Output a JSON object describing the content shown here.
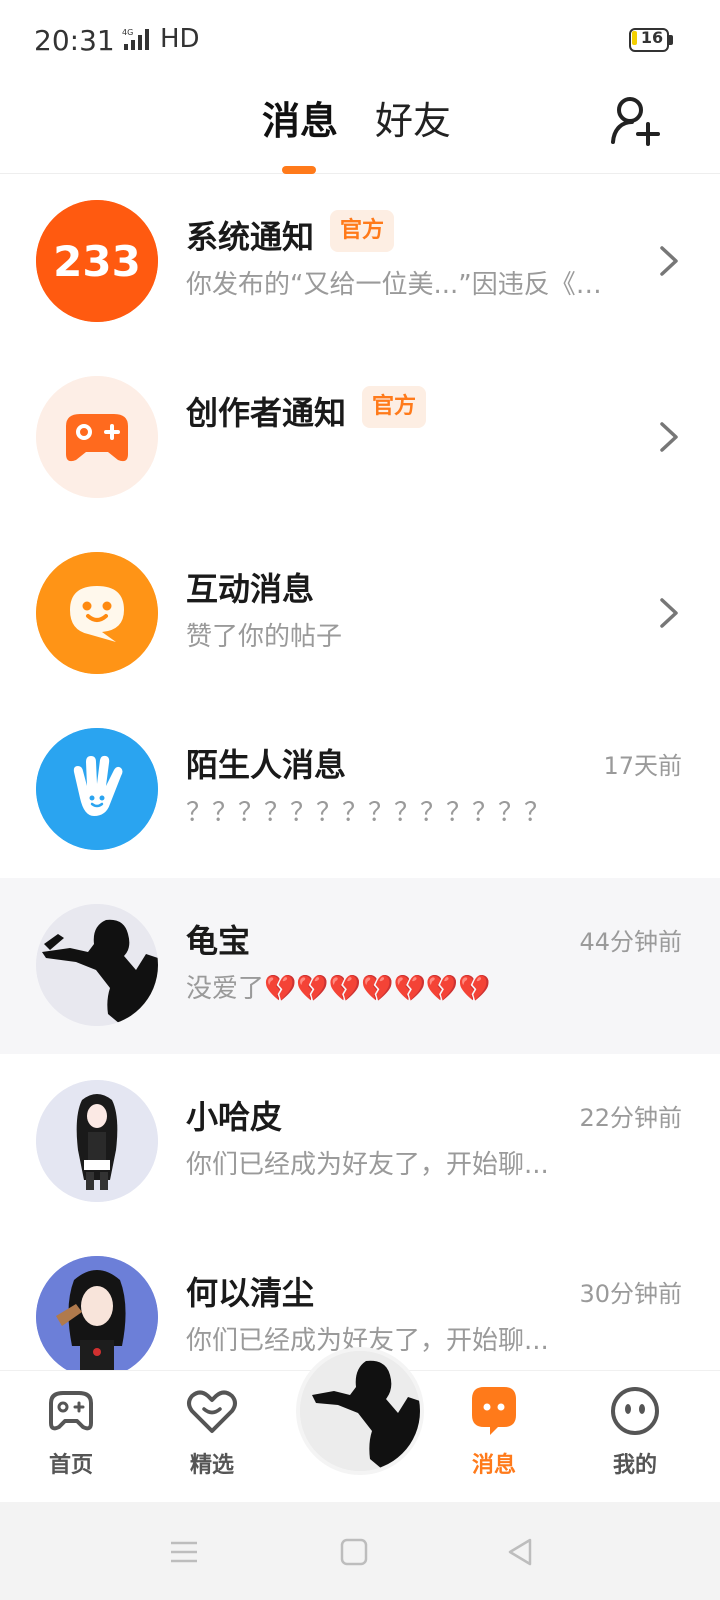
{
  "status_bar": {
    "time": "20:31",
    "network": "HD",
    "battery": "16"
  },
  "header": {
    "tabs": [
      {
        "label": "消息",
        "active": true
      },
      {
        "label": "好友",
        "active": false
      }
    ],
    "add_friend_icon": "add-user-icon"
  },
  "colors": {
    "accent": "#ff7a1a",
    "system_notice_avatar": "#ff5a10",
    "creator_notice_avatar": "#fdeee6",
    "interaction_avatar": "#ff9416",
    "stranger_avatar": "#2aa4f0"
  },
  "messages": [
    {
      "title": "系统通知",
      "badge": "官方",
      "preview": "你发布的“又给一位美...”因违反《社...",
      "time": "",
      "avatar_text": "233",
      "has_chevron": true
    },
    {
      "title": "创作者通知",
      "badge": "官方",
      "preview": "",
      "time": "",
      "avatar_icon": "gamepad-icon",
      "has_chevron": true
    },
    {
      "title": "互动消息",
      "badge": "",
      "preview": "赞了你的帖子",
      "time": "",
      "avatar_icon": "smile-bubble-icon",
      "has_chevron": true
    },
    {
      "title": "陌生人消息",
      "badge": "",
      "preview": "？？？？？？？？？？？？？？",
      "time": "17天前",
      "avatar_icon": "wave-hand-icon",
      "has_chevron": false
    },
    {
      "title": "龟宝",
      "badge": "",
      "preview": "没爱了💔💔💔💔💔💔💔",
      "time": "44分钟前",
      "avatar_icon": "silhouette-avatar",
      "has_chevron": false,
      "highlighted": true
    },
    {
      "title": "小哈皮",
      "badge": "",
      "preview": "你们已经成为好友了，开始聊...",
      "time": "22分钟前",
      "avatar_icon": "anime-girl-avatar",
      "has_chevron": false
    },
    {
      "title": "何以清尘",
      "badge": "",
      "preview": "你们已经成为好友了，开始聊...",
      "time": "30分钟前",
      "avatar_icon": "anime-girl-avatar",
      "has_chevron": false
    }
  ],
  "bottom_nav": [
    {
      "label": "首页",
      "icon": "gamepad-icon",
      "active": false
    },
    {
      "label": "精选",
      "icon": "heart-face-icon",
      "active": false
    },
    {
      "label": "",
      "icon": "center-avatar",
      "active": false
    },
    {
      "label": "消息",
      "icon": "message-icon",
      "active": true
    },
    {
      "label": "我的",
      "icon": "profile-face-icon",
      "active": false
    }
  ],
  "system_nav": [
    "menu-icon",
    "home-icon",
    "back-icon"
  ]
}
